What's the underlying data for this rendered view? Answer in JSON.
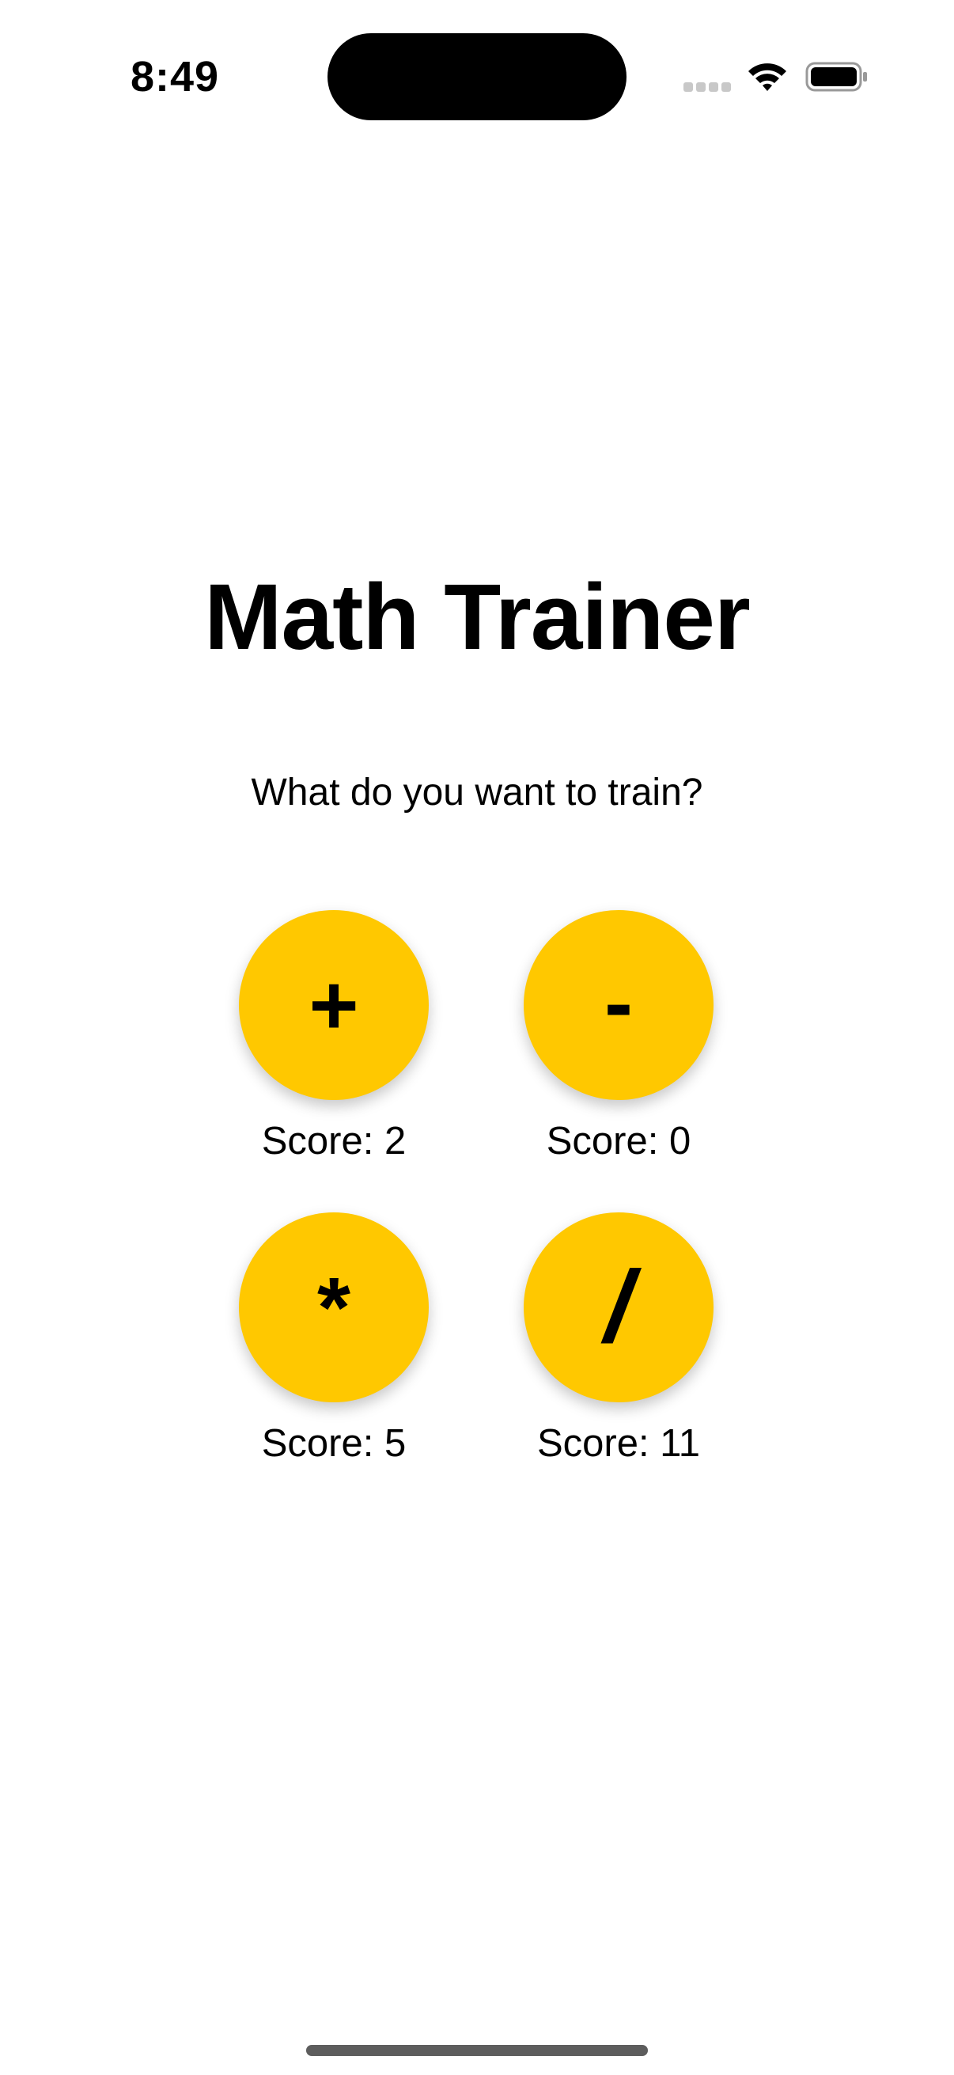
{
  "status_bar": {
    "time": "8:49",
    "icons": [
      "cellular-signal-icon",
      "wifi-icon",
      "battery-icon"
    ]
  },
  "app": {
    "title": "Math Trainer",
    "subtitle": "What do you want to train?",
    "accent_color": "#FFC800"
  },
  "operations": [
    {
      "symbol": "+",
      "score_label": "Score: 2"
    },
    {
      "symbol": "-",
      "score_label": "Score: 0"
    },
    {
      "symbol": "*",
      "score_label": "Score: 5"
    },
    {
      "symbol": "/",
      "score_label": "Score: 11"
    }
  ]
}
